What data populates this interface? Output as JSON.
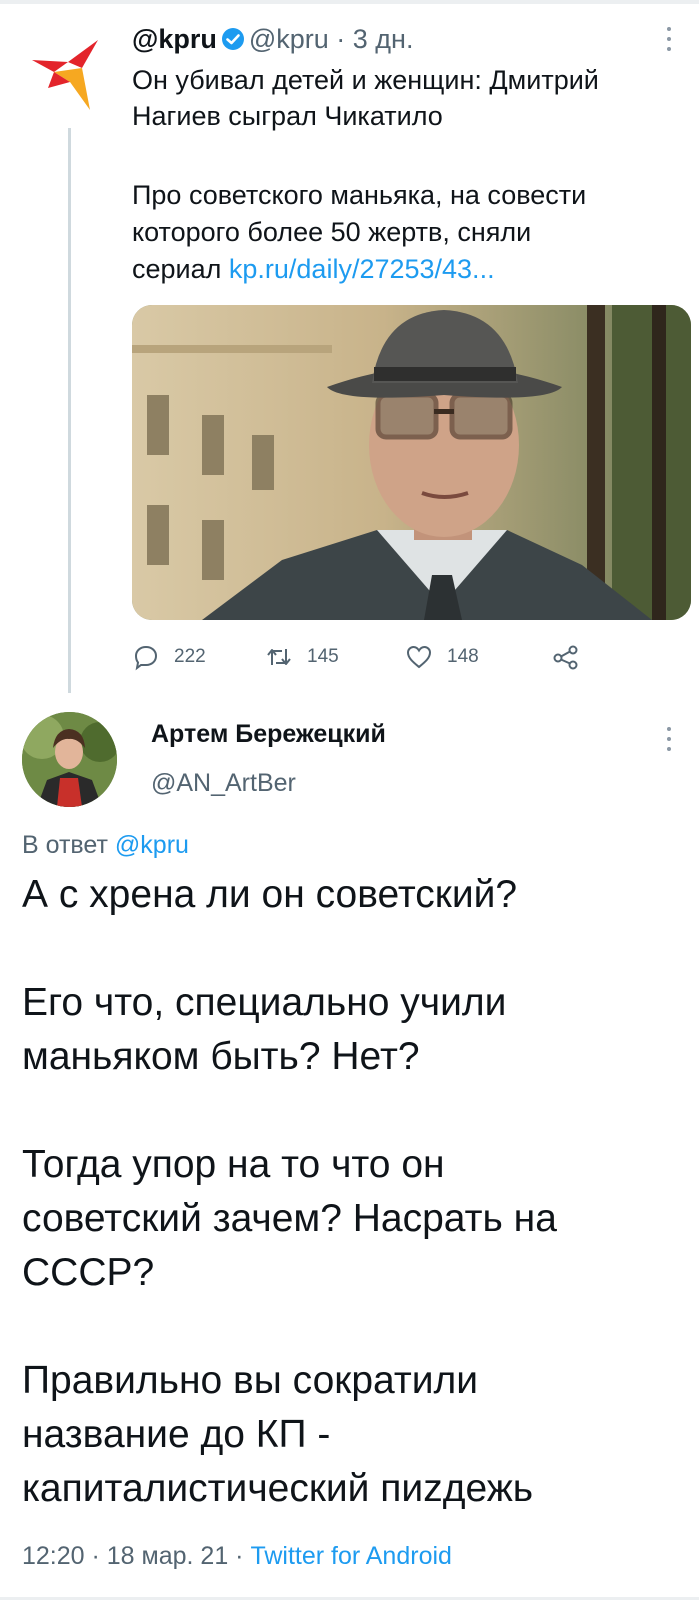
{
  "tweet": {
    "author_name": "@kpru",
    "author_handle": "@kpru",
    "time_ago": "3 дн.",
    "text": "Он убивал детей и женщин: Дмитрий Нагиев сыграл Чикатило",
    "body_lines": [
      "Про советского маньяка, на совести",
      "которого более 50 жертв, сняли"
    ],
    "body_last_prefix": "сериал ",
    "link_text": "kp.ru/daily/27253/43...",
    "stats": {
      "replies": "222",
      "retweets": "145",
      "likes": "148"
    }
  },
  "reply": {
    "author_name": "Артем Бережецкий",
    "author_handle": "@AN_ArtBer",
    "reply_to_prefix": "В ответ ",
    "reply_to_handle": "@kpru",
    "paragraphs": [
      "А с хрена ли он советский?",
      "Его что, специально учили маньяком быть? Нет?",
      "Тогда упор на то что он советский зачем? Насрать на СССР?",
      "Правильно вы сократили название до КП - капиталистический пиzдежь"
    ],
    "time": "12:20",
    "date": "18 мар. 21",
    "client": "Twitter for Android"
  },
  "colors": {
    "accent": "#1d9bf0",
    "secondary_text": "#536471",
    "logo_red": "#e3242b"
  },
  "icons": [
    "kp-logo-icon",
    "verified-icon",
    "more-icon",
    "reply-icon",
    "retweet-icon",
    "like-icon",
    "share-icon"
  ]
}
